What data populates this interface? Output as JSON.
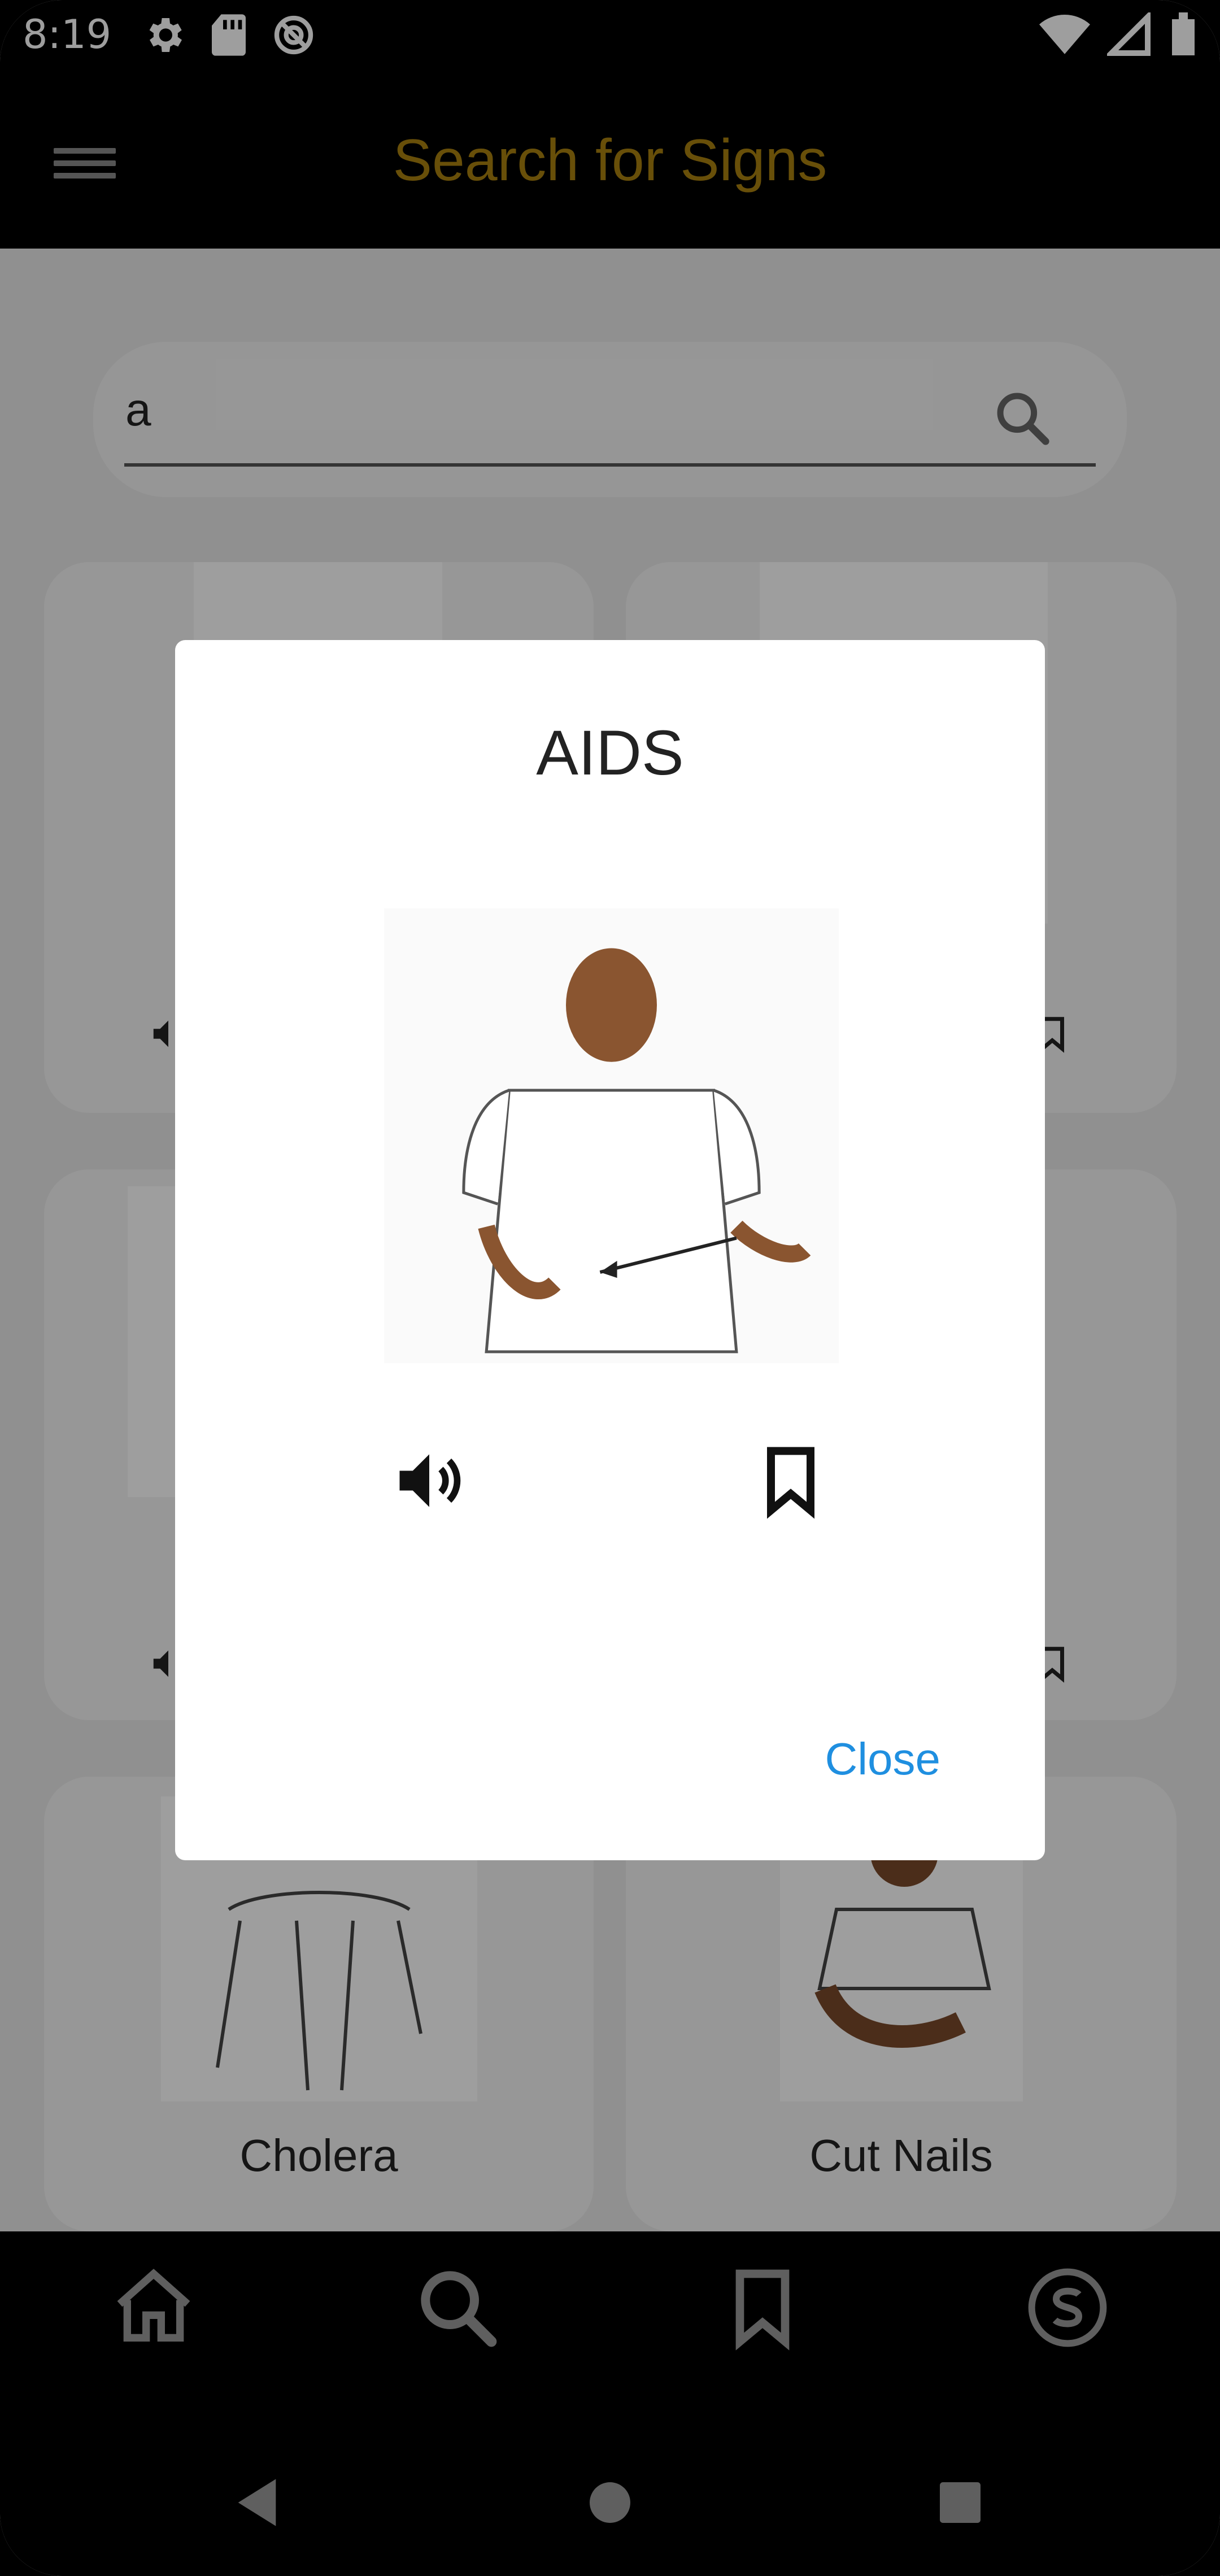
{
  "status_bar": {
    "time": "8:19"
  },
  "app_bar": {
    "title": "Search for Signs"
  },
  "search": {
    "value": "a"
  },
  "cards": [
    {
      "label": "Cholera"
    },
    {
      "label": "Cut Nails"
    }
  ],
  "dialog": {
    "title": "AIDS",
    "close_label": "Close"
  },
  "colors": {
    "title_gold": "#a8800f",
    "close_blue": "#1f8fe0"
  },
  "icons": {
    "menu": "menu-icon",
    "search": "search-icon",
    "volume": "volume-icon",
    "bookmark": "bookmark-icon",
    "home": "home-icon",
    "signs": "s-circle-icon"
  }
}
